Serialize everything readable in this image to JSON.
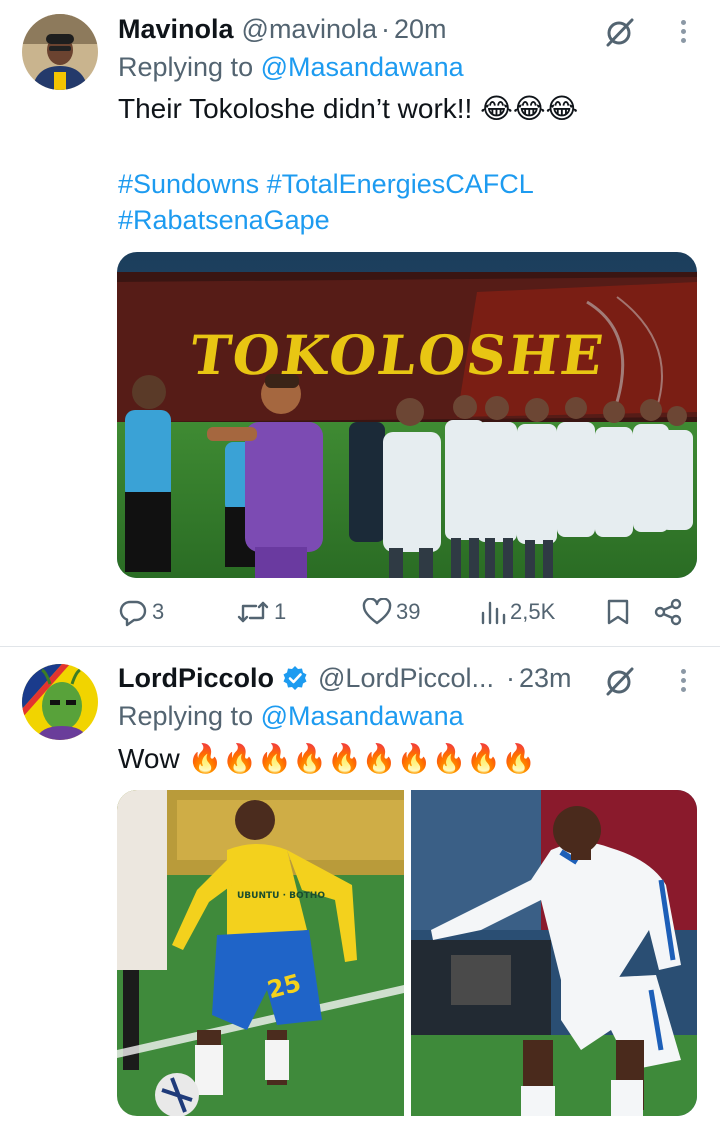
{
  "tweets": [
    {
      "name": "Mavinola",
      "handle": "@mavinola",
      "separator": "·",
      "time": "20m",
      "reply_prefix": "Replying to ",
      "reply_to": "@Masandawana",
      "text": "Their Tokoloshe didn’t work!! 😂😂😂",
      "hashtags_line1": "#Sundowns #TotalEnergiesCAFCL",
      "hashtags_line2": "#RabatsenaGape",
      "image_text": "TOKOLOSHE",
      "stats": {
        "replies": "3",
        "reposts": "1",
        "likes": "39",
        "views": "2,5K"
      }
    },
    {
      "name": "LordPiccolo",
      "verified": true,
      "handle": "@LordPiccol...",
      "separator": "·",
      "time": "23m",
      "reply_prefix": "Replying to ",
      "reply_to": "@Masandawana",
      "text": "Wow 🔥🔥🔥🔥🔥🔥🔥🔥🔥🔥",
      "player_number": "25",
      "sponsor_text": "UBUNTU · BOTHO"
    }
  ],
  "icons": [
    "grok-icon",
    "more-icon",
    "reply-icon",
    "repost-icon",
    "like-icon",
    "views-icon",
    "bookmark-icon",
    "share-icon",
    "verified-icon"
  ],
  "colors": {
    "link": "#1d9bf0",
    "secondary": "#536471",
    "verified": "#1d9bf0",
    "sundowns_yellow": "#f5d000"
  }
}
